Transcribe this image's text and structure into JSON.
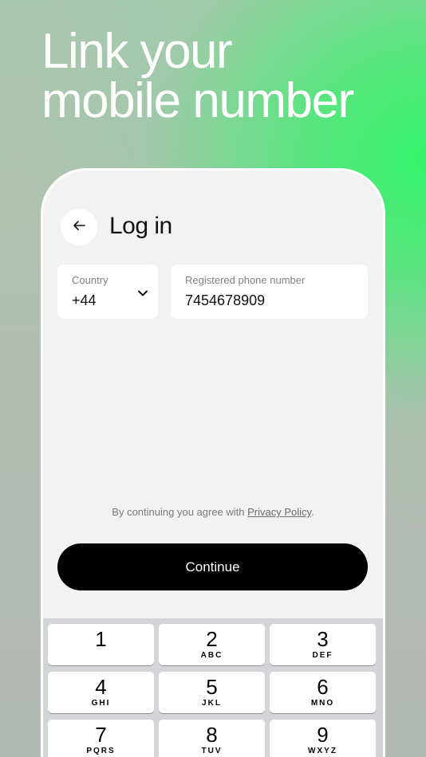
{
  "headline": {
    "line1": "Link your",
    "line2": "mobile number"
  },
  "screen": {
    "title": "Log in",
    "country": {
      "label": "Country",
      "value": "+44"
    },
    "phone": {
      "label": "Registered phone number",
      "value": "7454678909"
    },
    "legal": {
      "prefix": "By continuing you agree with ",
      "link": "Privacy Policy",
      "suffix": "."
    },
    "continue_label": "Continue"
  },
  "keypad": {
    "keys": [
      {
        "num": "1",
        "letters": ""
      },
      {
        "num": "2",
        "letters": "ABC"
      },
      {
        "num": "3",
        "letters": "DEF"
      },
      {
        "num": "4",
        "letters": "GHI"
      },
      {
        "num": "5",
        "letters": "JKL"
      },
      {
        "num": "6",
        "letters": "MNO"
      },
      {
        "num": "7",
        "letters": "PQRS"
      },
      {
        "num": "8",
        "letters": "TUV"
      },
      {
        "num": "9",
        "letters": "WXYZ"
      }
    ]
  },
  "colors": {
    "accent_green": "#35f56b",
    "button": "#000000",
    "screen_bg": "#f2f2f2"
  }
}
